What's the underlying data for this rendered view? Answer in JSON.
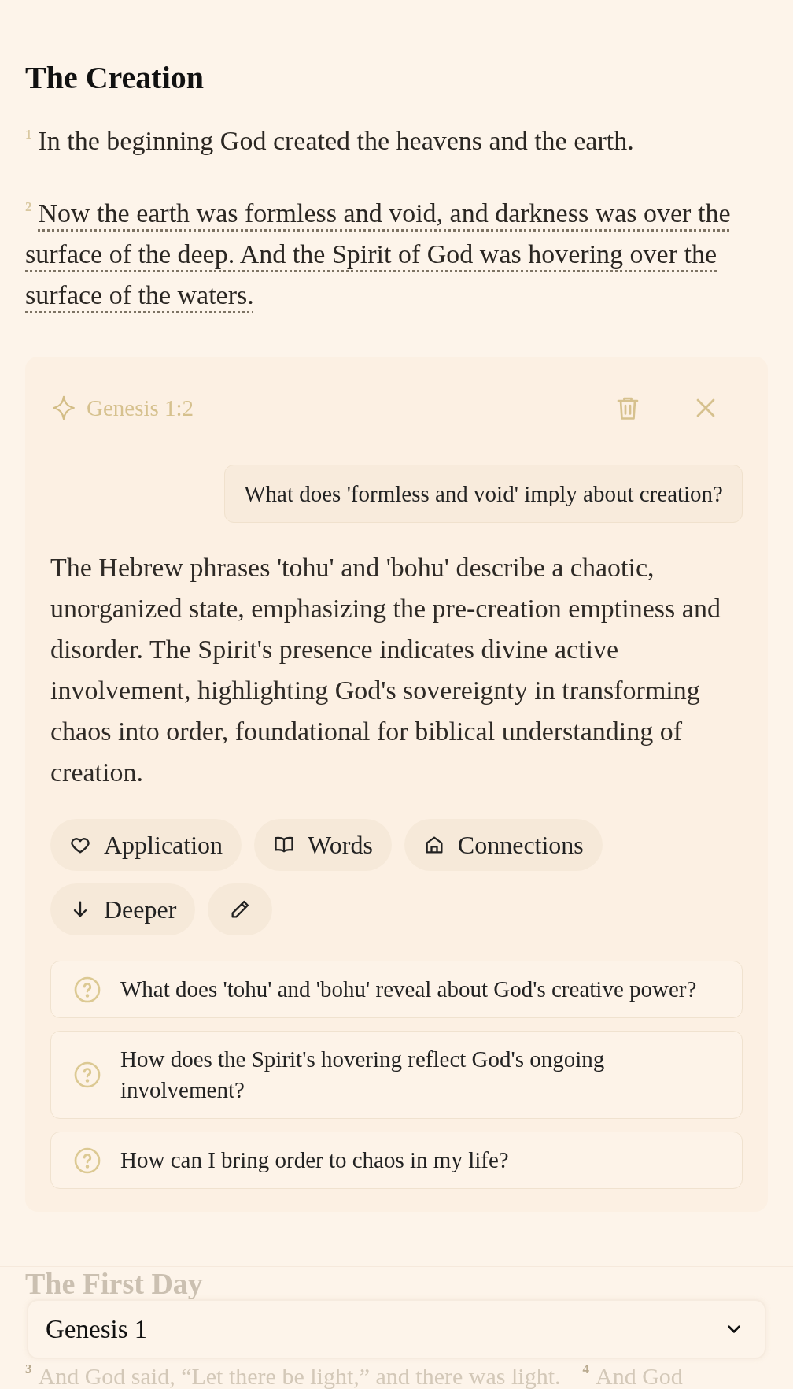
{
  "section": {
    "heading": "The Creation",
    "verses": [
      {
        "number": "1",
        "text": "In the beginning God created the heavens and the earth.",
        "selected": false
      },
      {
        "number": "2",
        "text": "Now the earth was formless and void, and darkness was over the surface of the deep. And the Spirit of God was hovering over the surface of the waters.",
        "selected": true
      }
    ]
  },
  "study_card": {
    "reference": "Genesis 1:2",
    "question": "What does 'formless and void' imply about creation?",
    "answer": "The Hebrew phrases 'tohu' and 'bohu' describe a chaotic, unorganized state, emphasizing the pre-creation emptiness and disorder. The Spirit's presence indicates divine active involvement, highlighting God's sovereignty in transforming chaos into order, foundational for biblical understanding of creation.",
    "actions": [
      {
        "kind": "heart",
        "label": "Application"
      },
      {
        "kind": "book",
        "label": "Words"
      },
      {
        "kind": "house",
        "label": "Connections"
      },
      {
        "kind": "down",
        "label": "Deeper"
      },
      {
        "kind": "pencil"
      }
    ],
    "suggestions": [
      "What does 'tohu' and 'bohu' reveal about God's creative power?",
      "How does the Spirit's hovering reflect God's ongoing involvement?",
      "How can I bring order to chaos in my life?"
    ]
  },
  "next_section": {
    "heading": "The First Day",
    "verses": [
      {
        "number": "3",
        "text": "And God said, “Let there be light,” and there was light."
      },
      {
        "number": "4",
        "text": "And God"
      }
    ]
  },
  "chapter_picker": {
    "value": "Genesis 1"
  }
}
